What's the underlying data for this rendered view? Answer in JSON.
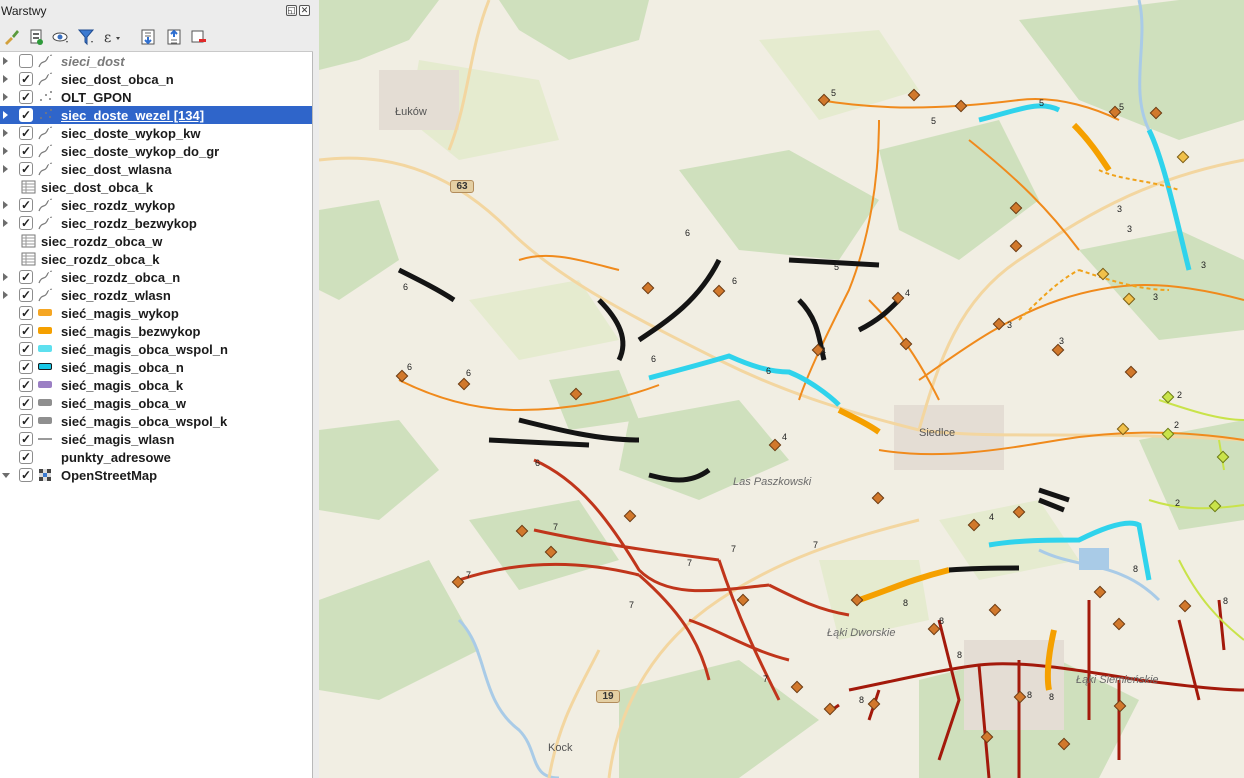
{
  "panel": {
    "title": "Warstwy",
    "float_glyph": "◱",
    "close_glyph": "✕",
    "toolbar_icons": [
      "style-brush-icon",
      "add-group-icon",
      "visibility-eye-icon",
      "filter-icon",
      "expression-filter-icon",
      "expand-all-icon",
      "collapse-all-icon",
      "remove-layer-icon"
    ],
    "epsilon_glyph": "ε"
  },
  "layers": [
    {
      "label": "sieci_dost",
      "checked": false,
      "arrow": true,
      "icon": "line-layer-icon",
      "italic": true
    },
    {
      "label": "siec_dost_obca_n",
      "checked": true,
      "arrow": true,
      "icon": "line-layer-icon"
    },
    {
      "label": "OLT_GPON",
      "checked": true,
      "arrow": true,
      "icon": "point-layer-icon"
    },
    {
      "label": "siec_doste_wezel [134]",
      "checked": true,
      "arrow": true,
      "icon": "point-layer-icon",
      "selected": true
    },
    {
      "label": "siec_doste_wykop_kw",
      "checked": true,
      "arrow": true,
      "icon": "line-layer-icon"
    },
    {
      "label": "siec_doste_wykop_do_gr",
      "checked": true,
      "arrow": true,
      "icon": "line-layer-icon"
    },
    {
      "label": "siec_dost_wlasna",
      "checked": true,
      "arrow": true,
      "icon": "line-layer-icon"
    },
    {
      "label": "siec_dost_obca_k",
      "table": true,
      "icon": "table-layer-icon"
    },
    {
      "label": "siec_rozdz_wykop",
      "checked": true,
      "arrow": true,
      "icon": "line-layer-icon"
    },
    {
      "label": "siec_rozdz_bezwykop",
      "checked": true,
      "arrow": true,
      "icon": "line-layer-icon"
    },
    {
      "label": "siec_rozdz_obca_w",
      "table": true,
      "icon": "table-layer-icon"
    },
    {
      "label": "siec_rozdz_obca_k",
      "table": true,
      "icon": "table-layer-icon"
    },
    {
      "label": "siec_rozdz_obca_n",
      "checked": true,
      "arrow": true,
      "icon": "line-layer-icon"
    },
    {
      "label": "siec_rozdz_wlasn",
      "checked": true,
      "arrow": true,
      "icon": "line-layer-icon"
    },
    {
      "label": "sieć_magis_wykop",
      "checked": true,
      "swatch": "#f5a623"
    },
    {
      "label": "sieć_magis_bezwykop",
      "checked": true,
      "swatch": "#f5a000"
    },
    {
      "label": "sieć_magis_obca_wspol_n",
      "checked": true,
      "swatch": "#5ee0ef"
    },
    {
      "label": "sieć_magis_obca_n",
      "checked": true,
      "swatch": "#19c7e6",
      "swatch_border": "#1a1a1a"
    },
    {
      "label": "sieć_magis_obca_k",
      "checked": true,
      "swatch": "#9b7fc4"
    },
    {
      "label": "sieć_magis_obca_w",
      "checked": true,
      "swatch": "#8f8f8f"
    },
    {
      "label": "sieć_magis_obca_wspol_k",
      "checked": true,
      "swatch": "#8f8f8f"
    },
    {
      "label": "sieć_magis_wlasn",
      "checked": true,
      "swatch": "#9a9a9a",
      "swatch_line": true
    },
    {
      "label": "punkty_adresowe",
      "checked": true
    },
    {
      "label": "OpenStreetMap",
      "checked": true,
      "arrow_open": true,
      "icon": "raster-layer-icon"
    }
  ],
  "map": {
    "place_labels": [
      {
        "text": "Łuków",
        "id": "lukow"
      },
      {
        "text": "Siedlce",
        "id": "siedlce"
      },
      {
        "text": "Las Paszkowski",
        "id": "las"
      },
      {
        "text": "Łąki Dworskie",
        "id": "laki-dworskie"
      },
      {
        "text": "Łąki Siemieńskie",
        "id": "laki-siemienskie"
      },
      {
        "text": "Kock",
        "id": "kock"
      }
    ],
    "road_shields": [
      "63",
      "19"
    ],
    "colors": {
      "background": "#f1eee3",
      "forest": "#cfe0bd",
      "field": "#e5ebcf",
      "water": "#a9cbe7",
      "network_orange": "#f08a1c",
      "network_red": "#c0351b",
      "network_darkred": "#a3190b",
      "network_black": "#141414",
      "network_cyan": "#2fd3ec",
      "network_yellow": "#f0a21a",
      "network_lime": "#c9e34a",
      "node_fill": "#d1782c"
    },
    "node_numbers": [
      "2",
      "3",
      "4",
      "5",
      "6",
      "7",
      "8"
    ]
  }
}
